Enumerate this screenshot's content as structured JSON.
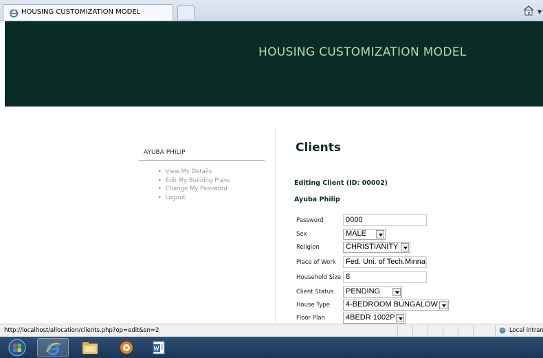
{
  "browser": {
    "tab_title": "HOUSING CUSTOMIZATION MODEL",
    "status_url": "http://localhost/allocation/clients.php?op=edit&sn=2",
    "zone": "Local intran"
  },
  "header": {
    "title": "HOUSING CUSTOMIZATION MODEL"
  },
  "sidebar": {
    "user": "AYUBA PHILIP",
    "items": [
      {
        "label": "View My Details"
      },
      {
        "label": "Edit My Building Plans"
      },
      {
        "label": "Change My Password"
      },
      {
        "label": "Logout"
      }
    ]
  },
  "main": {
    "heading": "Clients",
    "subheading": "Editing Client (ID: 00002)",
    "client_name": "Ayuba Philip",
    "fields": {
      "password": {
        "label": "Password",
        "value": "0000"
      },
      "sex": {
        "label": "Sex",
        "value": "MALE"
      },
      "religion": {
        "label": "Religion",
        "value": "CHRISTIANITY"
      },
      "place_of_work": {
        "label": "Place of Work",
        "value": "Fed. Uni. of Tech.Minna."
      },
      "household_size": {
        "label": "Household Size",
        "value": "8"
      },
      "client_status": {
        "label": "Client Status",
        "value": "PENDING"
      },
      "house_type": {
        "label": "House Type",
        "value": "4-BEDROOM BUNGALOW"
      },
      "floor_plan": {
        "label": "Floor Plan",
        "value": "4BEDR 1002P"
      }
    }
  },
  "colors": {
    "header_bg": "#0a2c27",
    "header_text": "#b8d9a8",
    "heading": "#0a2c27"
  },
  "icons": [
    "ie-icon",
    "home-icon",
    "start-orb-icon",
    "ie-taskbar-icon",
    "explorer-taskbar-icon",
    "media-player-taskbar-icon",
    "word-taskbar-icon",
    "zone-icon"
  ]
}
